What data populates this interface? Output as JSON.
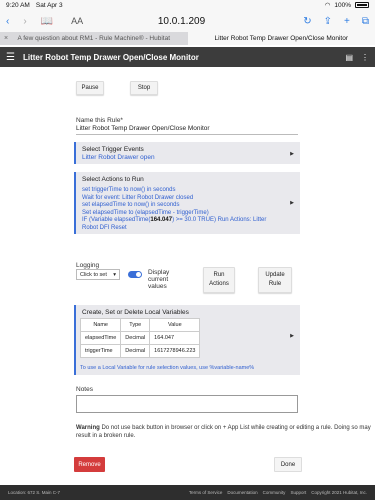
{
  "status": {
    "time": "9:20 AM",
    "date": "Sat Apr 3",
    "battery": "100%"
  },
  "browser": {
    "aa": "AA",
    "url": "10.0.1.209"
  },
  "tabs": [
    {
      "label": "A few question about RM1 - Rule Machine® - Hubitat"
    },
    {
      "label": "Litter Robot Temp Drawer Open/Close Monitor"
    }
  ],
  "app": {
    "title": "Litter Robot Temp Drawer Open/Close Monitor"
  },
  "buttons": {
    "pause": "Pause",
    "stop": "Stop",
    "run": "Run\nActions",
    "update": "Update\nRule",
    "remove": "Remove",
    "done": "Done"
  },
  "rule_name": {
    "label": "Name this Rule*",
    "value": "Litter Robot Temp Drawer Open/Close Monitor"
  },
  "triggers": {
    "title": "Select Trigger Events",
    "value": "Litter Robot Drawer open"
  },
  "actions": {
    "title": "Select Actions to Run",
    "lines": [
      "set triggerTime to now() in seconds",
      "Wait for event: Litter Robot Drawer closed",
      "set elapsedTime to now() in seconds",
      "Set elapsedTime to (elapsedTime - triggerTime)"
    ],
    "if_prefix": "IF (Variable elapsedTime(",
    "if_value": "164.047",
    "if_suffix": ") >= 30.0 TRUE) Run Actions: Litter Robot DFI Reset"
  },
  "logging": {
    "label": "Logging",
    "select": "Click to set",
    "display_label": "Display current values"
  },
  "variables": {
    "title": "Create, Set or Delete Local Variables",
    "headers": [
      "Name",
      "Type",
      "Value"
    ],
    "rows": [
      [
        "elapsedTime",
        "Decimal",
        "164.047"
      ],
      [
        "triggerTime",
        "Decimal",
        "1617278946.223"
      ]
    ],
    "hint": "To use a Local Variable for rule selection values, use %variable-name%"
  },
  "notes": {
    "label": "Notes"
  },
  "warning": {
    "bold": "Warning",
    "text": " Do not use back button in browser or click on + App List while creating or editing a rule. Doing so may result in a broken rule."
  },
  "footer": {
    "location": "Location: 672 S. Main C-7",
    "links": [
      "Terms of Service",
      "Documentation",
      "Community",
      "Support",
      "Copyright 2021 Hubitat, Inc."
    ]
  }
}
